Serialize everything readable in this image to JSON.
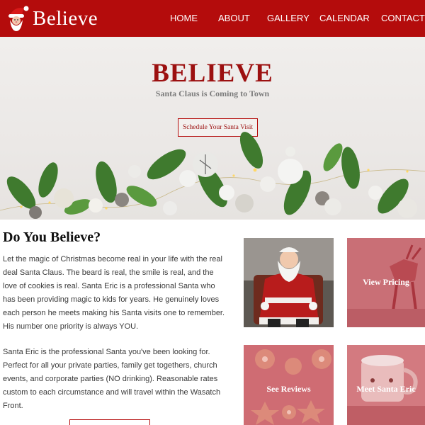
{
  "brand": {
    "logo_text": "Believe"
  },
  "nav": {
    "items": [
      {
        "label": "HOME"
      },
      {
        "label": "ABOUT"
      },
      {
        "label": "GALLERY"
      },
      {
        "label": "CALENDAR"
      },
      {
        "label": "CONTACT"
      }
    ]
  },
  "hero": {
    "title": "BELIEVE",
    "subtitle": "Santa Claus is Coming to Town",
    "button_label": "Schedule Your Santa Visit"
  },
  "main": {
    "heading": "Do You Believe?",
    "paragraph_1": "Let the magic of Christmas become real in your life with the real deal Santa Claus. The beard is real, the smile is real, and the love of cookies is real. Santa Eric is a professional Santa who has been providing magic to kids for years. He genuinely loves each person he meets making his Santa visits one to remember. His number one priority is always YOU.",
    "paragraph_2": "Santa Eric is the professional Santa you've been looking for. Perfect for all your private parties, family get togethers, church events, and corporate parties (NO drinking). Reasonable rates custom to each circumstance and will travel within the Wasatch Front."
  },
  "tiles": {
    "pricing": "View Pricing",
    "reviews": "See Reviews",
    "meet": "Meet Santa Eric"
  },
  "colors": {
    "brand_red": "#b40c0c",
    "title_red": "#9c1010",
    "tile_overlay": "#c9737a"
  }
}
